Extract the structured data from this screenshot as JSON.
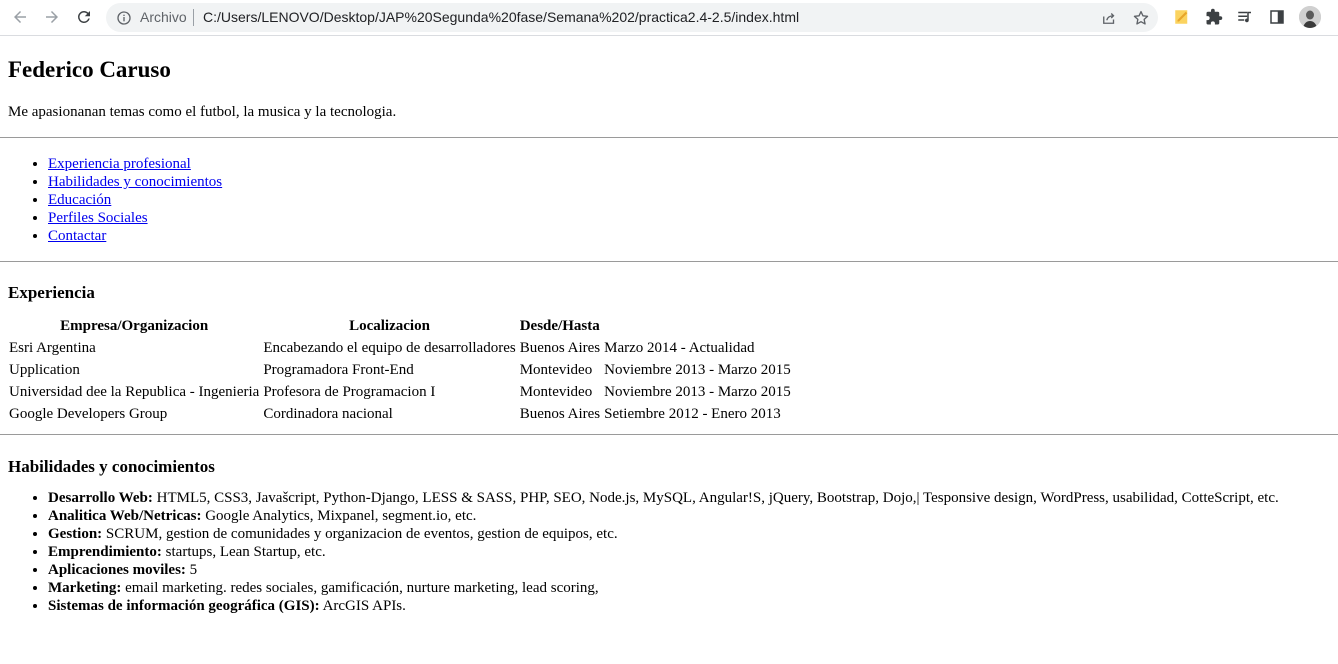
{
  "browser": {
    "origin_chip": "Archivo",
    "url": "C:/Users/LENOVO/Desktop/JAP%20Segunda%20fase/Semana%202/practica2.4-2.5/index.html"
  },
  "header": {
    "name": "Federico Caruso",
    "bio": "Me apasionanan temas como el futbol, la musica y la tecnologia."
  },
  "nav": {
    "links": [
      "Experiencia profesional",
      "Habilidades y conocimientos",
      "Educación",
      "Perfiles Sociales",
      "Contactar"
    ]
  },
  "experience": {
    "heading": "Experiencia",
    "columns": [
      "Empresa/Organizacion",
      "Localizacion",
      "Desde/Hasta"
    ],
    "rows": [
      [
        "Esri Argentina",
        "Encabezando el equipo de desarrolladores",
        "Buenos Aires",
        "Marzo 2014 - Actualidad"
      ],
      [
        "Upplication",
        "Programadora Front-End",
        "Montevideo",
        "Noviembre 2013 - Marzo 2015"
      ],
      [
        "Universidad dee la Republica - Ingenieria",
        "Profesora de Programacion I",
        "Montevideo",
        "Noviembre 2013 - Marzo 2015"
      ],
      [
        "Google Developers Group",
        "Cordinadora nacional",
        "Buenos Aires",
        "Setiembre 2012 - Enero 2013"
      ]
    ]
  },
  "skills": {
    "heading": "Habilidades y conocimientos",
    "items": [
      {
        "label": "Desarrollo Web:",
        "text": " HTML5, CSS3, Javašcript, Python-Django, LESS & SASS, PHP, SEO, Node.js, MySQL, Angular!S, jQuery, Bootstrap, Dojo,| Tesponsive design, WordPress, usabilidad, CotteScript, etc."
      },
      {
        "label": "Analitica Web/Netricas:",
        "text": " Google Analytics, Mixpanel, segment.io, etc."
      },
      {
        "label": "Gestion:",
        "text": " SCRUM, gestion de comunidades y organizacion de eventos, gestion de equipos, etc."
      },
      {
        "label": "Emprendimiento:",
        "text": " startups, Lean Startup, etc."
      },
      {
        "label": "Aplicaciones moviles:",
        "text": " 5"
      },
      {
        "label": "Marketing:",
        "text": " email marketing. redes sociales, gamificación, nurture marketing, lead scoring,"
      },
      {
        "label": "Sistemas de información geográfica (GIS):",
        "text": " ArcGIS APIs."
      }
    ]
  },
  "icons": {
    "back": "arrow-left-icon",
    "forward": "arrow-right-icon",
    "reload": "reload-icon",
    "info": "info-icon",
    "share": "share-icon",
    "bookmark": "star-icon",
    "extension_1": "note-extension-icon",
    "extensions": "puzzle-icon",
    "media": "media-queue-icon",
    "side_panel": "side-panel-icon",
    "profile": "avatar"
  },
  "colors": {
    "link": "#0000ee",
    "omnibox_bg": "#f1f3f4",
    "icon": "#5f6368"
  }
}
